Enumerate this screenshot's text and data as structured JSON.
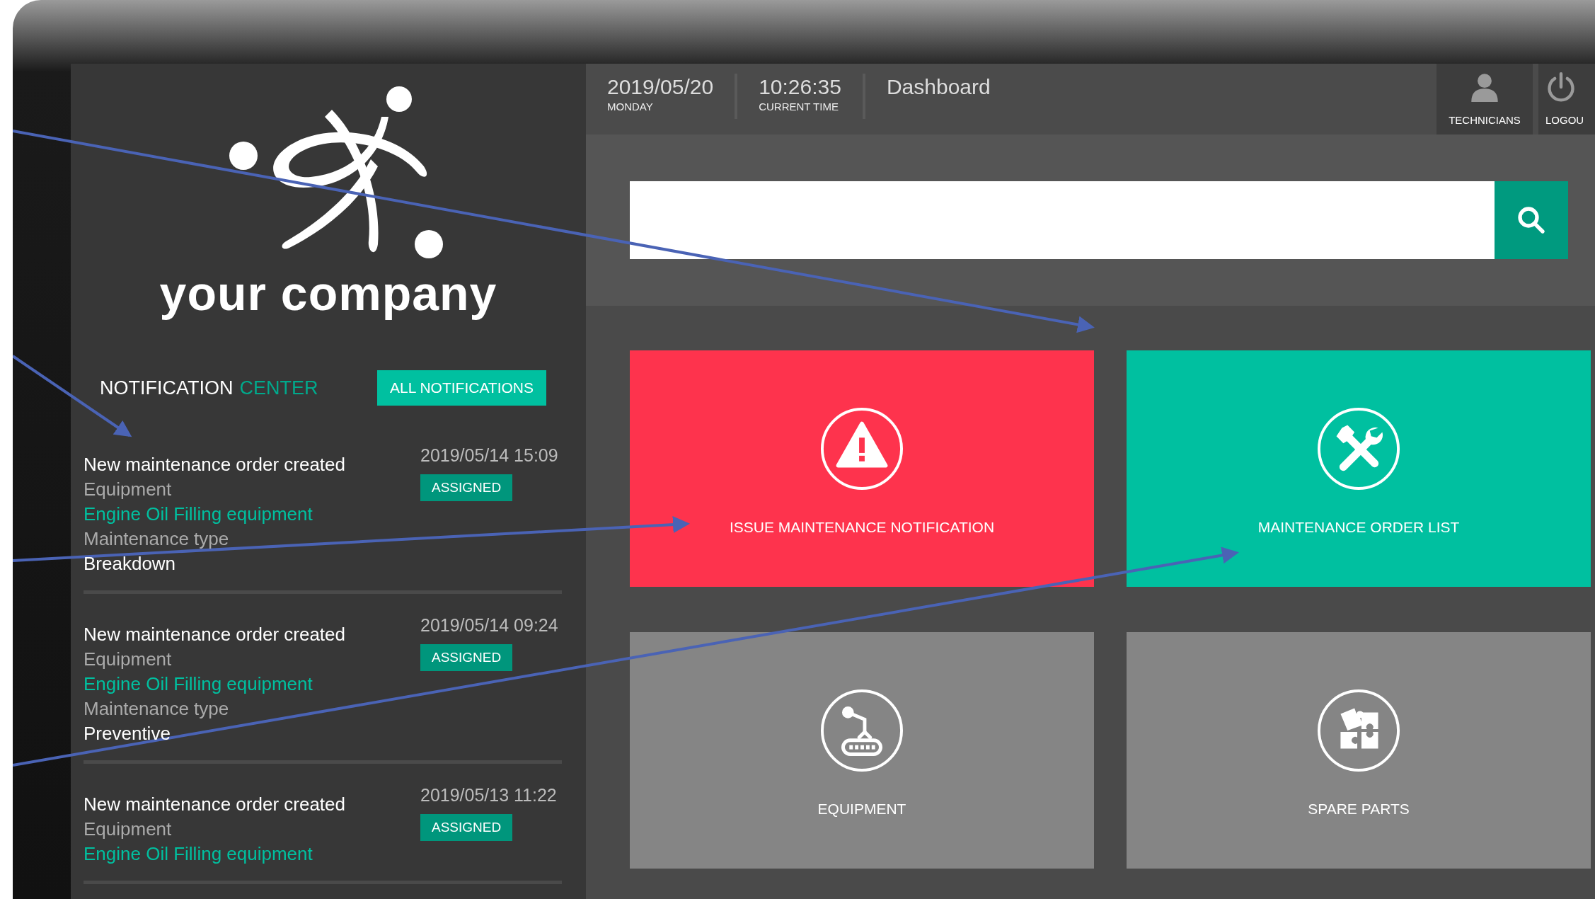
{
  "logo": {
    "text": "your company"
  },
  "header": {
    "date": "2019/05/20",
    "day": "MONDAY",
    "time": "10:26:35",
    "time_label": "CURRENT TIME",
    "page_title": "Dashboard",
    "buttons": [
      {
        "kind": "technicians",
        "label": "TECHNICIANS"
      },
      {
        "kind": "logout",
        "label": "LOGOU"
      }
    ]
  },
  "notification_center": {
    "title": "NOTIFICATION",
    "title_accent": "CENTER",
    "button": "ALL NOTIFICATIONS"
  },
  "notifications": [
    {
      "title": "New maintenance order created",
      "equipment_label": "Equipment",
      "equipment": "Engine Oil Filling equipment",
      "type_label": "Maintenance type",
      "type": "Breakdown",
      "date": "2019/05/14 15:09",
      "status": "ASSIGNED"
    },
    {
      "title": "New maintenance order created",
      "equipment_label": "Equipment",
      "equipment": "Engine Oil Filling equipment",
      "type_label": "Maintenance type",
      "type": "Preventive",
      "date": "2019/05/14 09:24",
      "status": "ASSIGNED"
    },
    {
      "title": "New maintenance order created",
      "equipment_label": "Equipment",
      "equipment": "Engine Oil Filling equipment",
      "date": "2019/05/13 11:22",
      "status": "ASSIGNED"
    }
  ],
  "tiles": [
    {
      "kind": "warning",
      "label": "ISSUE MAINTENANCE NOTIFICATION",
      "color": "#fe334d"
    },
    {
      "kind": "tools",
      "label": "MAINTENANCE ORDER LIST",
      "color": "#00c0a0"
    },
    {
      "kind": "robot",
      "label": "EQUIPMENT",
      "color": "#858585"
    },
    {
      "kind": "puzzle",
      "label": "SPARE PARTS",
      "color": "#858585"
    }
  ]
}
